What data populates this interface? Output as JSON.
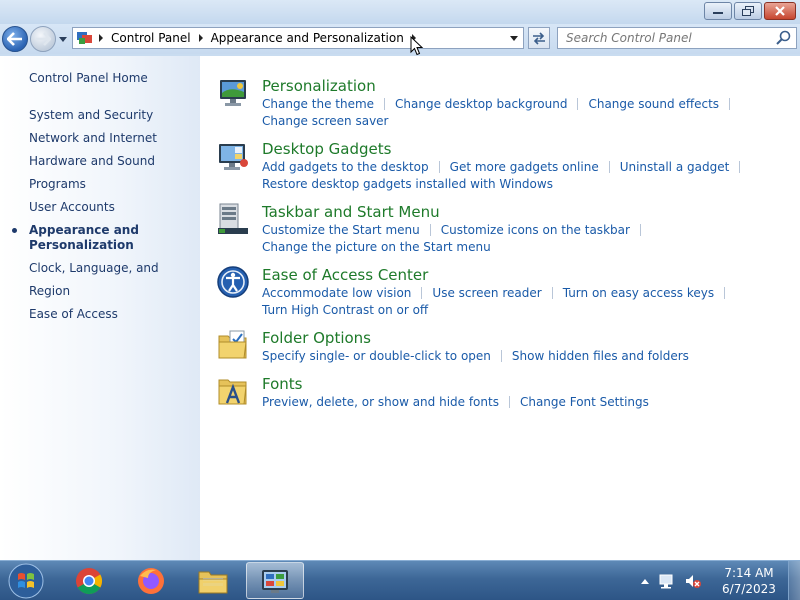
{
  "window": {
    "controls": {
      "minimize": "minimize",
      "maximize": "maximize",
      "close": "close"
    }
  },
  "address": {
    "breadcrumbs": [
      "Control Panel",
      "Appearance and Personalization"
    ],
    "search_placeholder": "Search Control Panel"
  },
  "sidebar": {
    "home": "Control Panel Home",
    "items": [
      {
        "label": "System and Security"
      },
      {
        "label": "Network and Internet"
      },
      {
        "label": "Hardware and Sound"
      },
      {
        "label": "Programs"
      },
      {
        "label": "User Accounts"
      },
      {
        "label": "Appearance and Personalization",
        "active": true
      },
      {
        "label": "Clock, Language, and Region"
      },
      {
        "label": "Ease of Access"
      }
    ]
  },
  "categories": [
    {
      "title": "Personalization",
      "icon": "personalization-icon",
      "links": [
        "Change the theme",
        "Change desktop background",
        "Change sound effects",
        "Change screen saver"
      ]
    },
    {
      "title": "Desktop Gadgets",
      "icon": "gadgets-icon",
      "links": [
        "Add gadgets to the desktop",
        "Get more gadgets online",
        "Uninstall a gadget",
        "Restore desktop gadgets installed with Windows"
      ]
    },
    {
      "title": "Taskbar and Start Menu",
      "icon": "taskbar-icon",
      "links": [
        "Customize the Start menu",
        "Customize icons on the taskbar",
        "Change the picture on the Start menu"
      ]
    },
    {
      "title": "Ease of Access Center",
      "icon": "ease-of-access-icon",
      "links": [
        "Accommodate low vision",
        "Use screen reader",
        "Turn on easy access keys",
        "Turn High Contrast on or off"
      ]
    },
    {
      "title": "Folder Options",
      "icon": "folder-options-icon",
      "links": [
        "Specify single- or double-click to open",
        "Show hidden files and folders"
      ]
    },
    {
      "title": "Fonts",
      "icon": "fonts-icon",
      "links": [
        "Preview, delete, or show and hide fonts",
        "Change Font Settings"
      ]
    }
  ],
  "taskbar": {
    "apps": [
      "chrome-icon",
      "firefox-icon",
      "explorer-icon",
      "control-panel-icon"
    ],
    "time": "7:14 AM",
    "date": "6/7/2023"
  },
  "colors": {
    "link": "#1a5aa8",
    "category_title": "#1e7a2a",
    "sidebar_text": "#1e3a6b"
  }
}
